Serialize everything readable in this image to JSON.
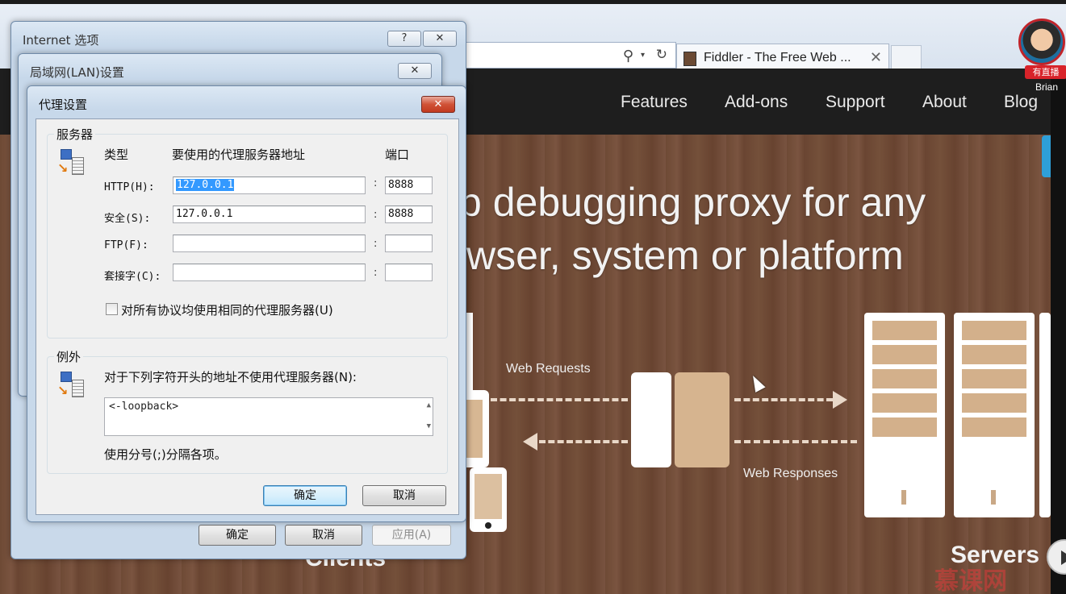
{
  "browser": {
    "tab_title": "Fiddler - The Free Web ...",
    "tab_close": "✕",
    "search_icon": "⚲",
    "dropdown_icon": "▾",
    "refresh_icon": "↻"
  },
  "site": {
    "nav": [
      "Features",
      "Add-ons",
      "Support",
      "About",
      "Blog"
    ],
    "headline_line1": "b debugging proxy for any",
    "headline_line2": "wser, system or platform",
    "web_requests": "Web Requests",
    "web_responses": "Web Responses",
    "clients": "Clients",
    "servers": "Servers"
  },
  "overlay": {
    "live_badge": "有直播",
    "streamer": "Brian",
    "watermark": "慕课网"
  },
  "internet_options": {
    "title": "Internet 选项",
    "help": "?",
    "close": "✕",
    "ok": "确定",
    "cancel": "取消",
    "apply": "应用(A)"
  },
  "lan_settings": {
    "title": "局域网(LAN)设置",
    "close": "✕"
  },
  "proxy_settings": {
    "title": "代理设置",
    "close": "✕",
    "servers_group": "服务器",
    "col_type": "类型",
    "col_address": "要使用的代理服务器地址",
    "col_port": "端口",
    "rows": [
      {
        "label": "HTTP(H):",
        "address": "127.0.0.1",
        "port": "8888"
      },
      {
        "label": "安全(S):",
        "address": "127.0.0.1",
        "port": "8888"
      },
      {
        "label": "FTP(F):",
        "address": "",
        "port": ""
      },
      {
        "label": "套接字(C):",
        "address": "",
        "port": ""
      }
    ],
    "same_proxy_checkbox": "对所有协议均使用相同的代理服务器(U)",
    "same_proxy_checked": false,
    "exceptions_group": "例外",
    "exceptions_label": "对于下列字符开头的地址不使用代理服务器(N):",
    "exceptions_value": "<-loopback>",
    "exceptions_hint": "使用分号(;)分隔各项。",
    "ok": "确定",
    "cancel": "取消"
  }
}
